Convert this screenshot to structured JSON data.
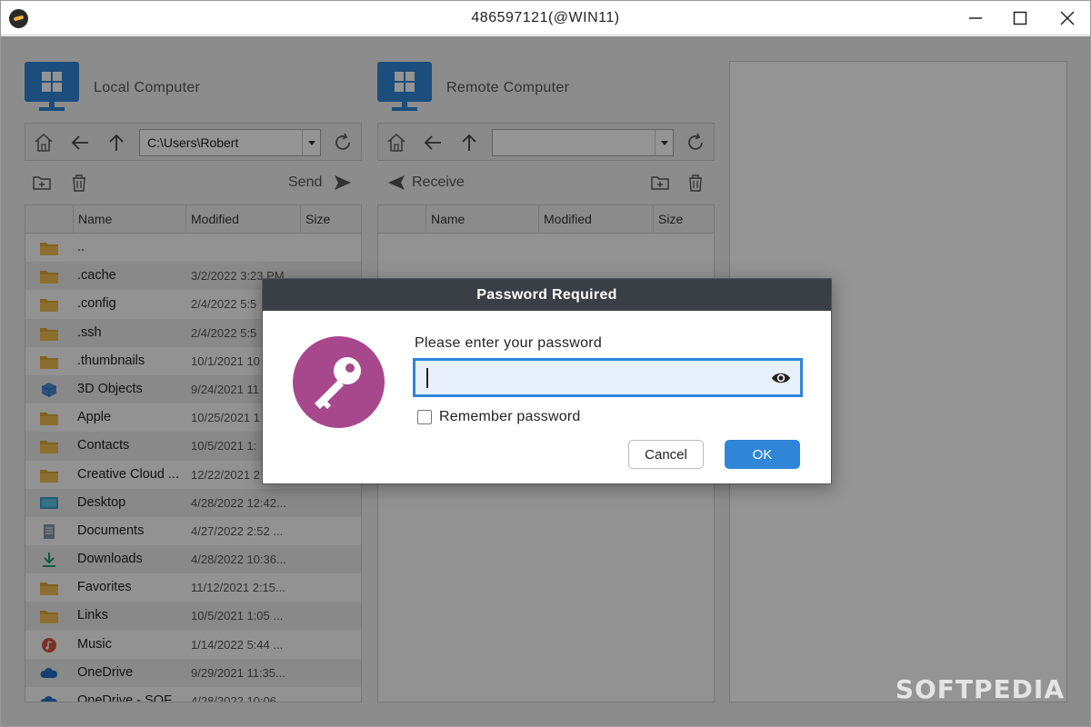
{
  "window": {
    "title": "486597121(@WIN11)",
    "controls": [
      "minimize-icon",
      "maximize-icon",
      "close-icon"
    ]
  },
  "local": {
    "title": "Local Computer",
    "path": "C:\\Users\\Robert",
    "send_label": "Send",
    "columns": [
      "Name",
      "Modified",
      "Size"
    ],
    "files": [
      {
        "name": "..",
        "modified": "",
        "icon": "folder-icon"
      },
      {
        "name": ".cache",
        "modified": "3/2/2022 3:23 PM",
        "icon": "folder-icon"
      },
      {
        "name": ".config",
        "modified": "2/4/2022 5:5",
        "icon": "folder-icon"
      },
      {
        "name": ".ssh",
        "modified": "2/4/2022 5:5",
        "icon": "folder-icon"
      },
      {
        "name": ".thumbnails",
        "modified": "10/1/2021 10",
        "icon": "folder-icon"
      },
      {
        "name": "3D Objects",
        "modified": "9/24/2021 11",
        "icon": "cube-icon"
      },
      {
        "name": "Apple",
        "modified": "10/25/2021 1",
        "icon": "folder-icon"
      },
      {
        "name": "Contacts",
        "modified": "10/5/2021 1:",
        "icon": "folder-icon"
      },
      {
        "name": "Creative Cloud ...",
        "modified": "12/22/2021 2",
        "icon": "folder-icon"
      },
      {
        "name": "Desktop",
        "modified": "4/28/2022 12:42...",
        "icon": "desktop-icon"
      },
      {
        "name": "Documents",
        "modified": "4/27/2022 2:52 ...",
        "icon": "document-icon"
      },
      {
        "name": "Downloads",
        "modified": "4/28/2022 10:36...",
        "icon": "download-icon"
      },
      {
        "name": "Favorites",
        "modified": "11/12/2021 2:15...",
        "icon": "folder-icon"
      },
      {
        "name": "Links",
        "modified": "10/5/2021 1:05 ...",
        "icon": "folder-icon"
      },
      {
        "name": "Music",
        "modified": "1/14/2022 5:44 ...",
        "icon": "music-icon"
      },
      {
        "name": "OneDrive",
        "modified": "9/29/2021 11:35...",
        "icon": "cloud-icon"
      },
      {
        "name": "OneDrive - SOF",
        "modified": "4/28/2022 10:06",
        "icon": "cloud-icon"
      }
    ]
  },
  "remote": {
    "title": "Remote Computer",
    "path": "",
    "receive_label": "Receive",
    "columns": [
      "Name",
      "Modified",
      "Size"
    ]
  },
  "dialog": {
    "title": "Password Required",
    "prompt": "Please enter your password",
    "password_value": "",
    "remember_label": "Remember password",
    "remember_checked": false,
    "cancel_label": "Cancel",
    "ok_label": "OK",
    "accent_color": "#2f86d8",
    "key_circle_color": "#a7488c"
  },
  "watermark": "SOFTPEDIA"
}
